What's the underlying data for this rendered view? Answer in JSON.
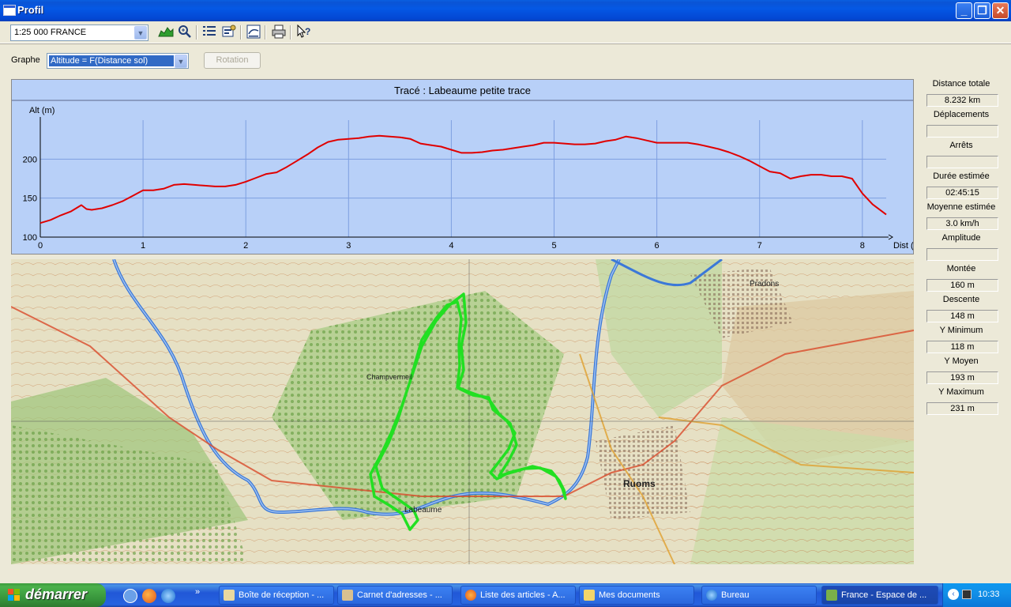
{
  "window": {
    "title": "Profil",
    "controls": [
      "minimize",
      "maximize",
      "close"
    ]
  },
  "toolbar": {
    "scale_value": "1:25 000 FRANCE",
    "icons": [
      "profile-chart-icon",
      "zoom-icon",
      "list-icon",
      "properties-icon",
      "export-icon",
      "print-icon",
      "help-icon"
    ]
  },
  "graphe": {
    "label": "Graphe",
    "selected": "Altitude = F(Distance sol)",
    "rotation_label": "Rotation"
  },
  "chart_data": {
    "type": "line",
    "title": "Tracé : Labeaume petite trace",
    "xlabel": "Dist (km)",
    "ylabel": "Alt (m)",
    "xlim": [
      0,
      8.232
    ],
    "ylim": [
      100,
      250
    ],
    "x_ticks": [
      "0",
      "1",
      "2",
      "3",
      "4",
      "5",
      "6",
      "7",
      "8"
    ],
    "y_ticks": [
      "100",
      "150",
      "200"
    ],
    "grid": true,
    "color": "#E00000",
    "series": [
      {
        "x": [
          0,
          0.1,
          0.2,
          0.3,
          0.4,
          0.45,
          0.5,
          0.6,
          0.7,
          0.8,
          0.9,
          1.0,
          1.1,
          1.2,
          1.3,
          1.4,
          1.5,
          1.6,
          1.7,
          1.8,
          1.9,
          2.0,
          2.1,
          2.2,
          2.3,
          2.4,
          2.5,
          2.6,
          2.7,
          2.8,
          2.9,
          3.0,
          3.1,
          3.2,
          3.3,
          3.4,
          3.5,
          3.6,
          3.7,
          3.8,
          3.9,
          4.0,
          4.1,
          4.2,
          4.3,
          4.4,
          4.5,
          4.6,
          4.7,
          4.8,
          4.9,
          5.0,
          5.1,
          5.2,
          5.3,
          5.4,
          5.5,
          5.6,
          5.7,
          5.8,
          5.9,
          6.0,
          6.1,
          6.2,
          6.3,
          6.4,
          6.5,
          6.6,
          6.7,
          6.8,
          6.9,
          7.0,
          7.1,
          7.2,
          7.3,
          7.4,
          7.5,
          7.6,
          7.7,
          7.8,
          7.9,
          8.0,
          8.1,
          8.232
        ],
        "y": [
          118,
          122,
          128,
          133,
          141,
          136,
          135,
          137,
          141,
          146,
          153,
          160,
          160,
          162,
          167,
          168,
          167,
          166,
          165,
          165,
          167,
          171,
          176,
          181,
          183,
          190,
          198,
          206,
          215,
          222,
          225,
          226,
          227,
          229,
          230,
          229,
          228,
          226,
          220,
          218,
          216,
          212,
          208,
          208,
          209,
          211,
          212,
          214,
          216,
          218,
          221,
          221,
          220,
          219,
          219,
          220,
          223,
          225,
          229,
          227,
          224,
          221,
          221,
          221,
          221,
          219,
          216,
          213,
          209,
          204,
          198,
          191,
          184,
          182,
          175,
          178,
          180,
          180,
          178,
          178,
          175,
          156,
          142,
          129
        ]
      }
    ]
  },
  "stats": [
    {
      "label": "Distance totale",
      "value": "8.232 km"
    },
    {
      "label": "Déplacements",
      "value": ""
    },
    {
      "label": "Arrêts",
      "value": ""
    },
    {
      "label": "Durée estimée",
      "value": "02:45:15"
    },
    {
      "label": "Moyenne estimée",
      "value": "3.0 km/h"
    },
    {
      "label": "Amplitude",
      "value": ""
    },
    {
      "label": "Montée",
      "value": "160 m"
    },
    {
      "label": "Descente",
      "value": "148 m"
    },
    {
      "label": "Y Minimum",
      "value": "118 m"
    },
    {
      "label": "Y Moyen",
      "value": "193 m"
    },
    {
      "label": "Y Maximum",
      "value": "231 m"
    }
  ],
  "map": {
    "labels": [
      "Labeaume",
      "Ruoms",
      "Pradons",
      "Champvermeil"
    ],
    "route_color": "#22E022"
  },
  "taskbar": {
    "start_label": "démarrer",
    "tasks": [
      {
        "label": "Boîte de réception - ...",
        "icon": "mail-icon"
      },
      {
        "label": "Carnet d'adresses - ...",
        "icon": "addressbook-icon"
      },
      {
        "label": "Liste des articles - A...",
        "icon": "firefox-icon"
      },
      {
        "label": "Mes documents",
        "icon": "folder-icon"
      },
      {
        "label": "Bureau",
        "icon": "ie-icon"
      },
      {
        "label": "France - Espace de ...",
        "icon": "map-app-icon"
      }
    ],
    "clock": "10:33"
  }
}
